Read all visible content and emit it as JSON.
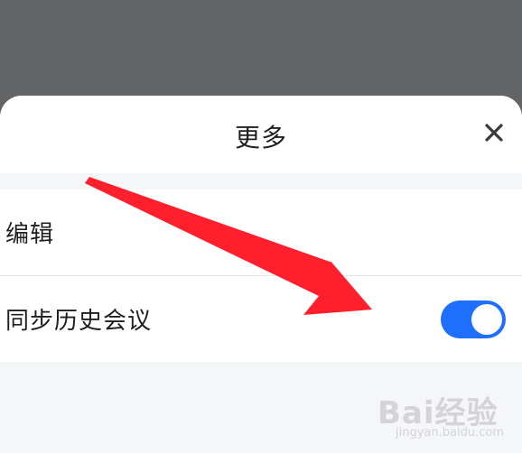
{
  "sheet": {
    "title": "更多",
    "close_icon": "close-icon"
  },
  "rows": [
    {
      "label": "编辑"
    },
    {
      "label": "同步历史会议",
      "toggle_on": true
    }
  ],
  "colors": {
    "overlay": "#636466",
    "toggle_on": "#1f6fff",
    "arrow": "#ff1f2d"
  },
  "watermark": {
    "main": "Bai经验",
    "sub": "jingyan.baidu.com"
  }
}
